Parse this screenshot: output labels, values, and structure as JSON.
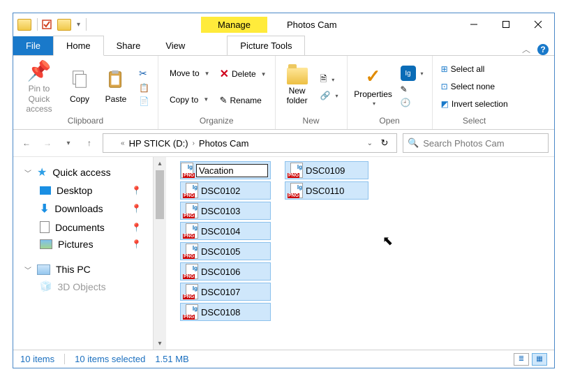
{
  "window": {
    "title": "Photos Cam",
    "contextual_tab": "Manage",
    "picture_tools": "Picture Tools"
  },
  "tabs": {
    "file": "File",
    "home": "Home",
    "share": "Share",
    "view": "View"
  },
  "ribbon": {
    "clipboard": {
      "label": "Clipboard",
      "pin": "Pin to Quick access",
      "copy": "Copy",
      "paste": "Paste"
    },
    "organize": {
      "label": "Organize",
      "move_to": "Move to",
      "copy_to": "Copy to",
      "delete": "Delete",
      "rename": "Rename"
    },
    "new": {
      "label": "New",
      "new_folder": "New folder"
    },
    "open": {
      "label": "Open",
      "properties": "Properties"
    },
    "select": {
      "label": "Select",
      "select_all": "Select all",
      "select_none": "Select none",
      "invert": "Invert selection"
    }
  },
  "address": {
    "seg1": "HP STICK (D:)",
    "seg2": "Photos Cam"
  },
  "search": {
    "placeholder": "Search Photos Cam"
  },
  "nav": {
    "quick_access": "Quick access",
    "desktop": "Desktop",
    "downloads": "Downloads",
    "documents": "Documents",
    "pictures": "Pictures",
    "this_pc": "This PC",
    "three_d": "3D Objects"
  },
  "files": {
    "rename_value": "Vacation",
    "col1": [
      "DSC0102",
      "DSC0103",
      "DSC0104",
      "DSC0105",
      "DSC0106",
      "DSC0107",
      "DSC0108"
    ],
    "col2": [
      "DSC0109",
      "DSC0110"
    ]
  },
  "status": {
    "count": "10 items",
    "selected": "10 items selected",
    "size": "1.51 MB"
  }
}
